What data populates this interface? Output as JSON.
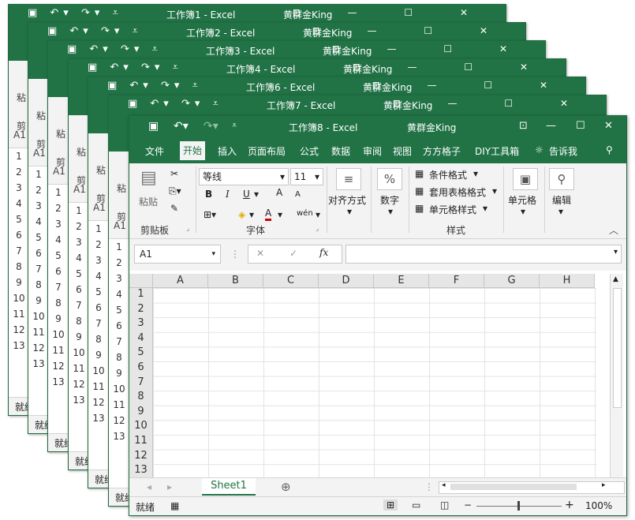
{
  "app": "Excel",
  "back_windows": [
    {
      "title": "工作簿1  -  Excel",
      "user": "黄群金King"
    },
    {
      "title": "工作簿2  -  Excel",
      "user": "黄群金King"
    },
    {
      "title": "工作簿3  -  Excel",
      "user": "黄群金King"
    },
    {
      "title": "工作簿4  -  Excel",
      "user": "黄群金King"
    },
    {
      "title": "工作簿6  -  Excel",
      "user": "黄群金King"
    },
    {
      "title": "工作簿7  -  Excel",
      "user": "黄群金King"
    }
  ],
  "back_common": {
    "paste_label": "粘",
    "cut_label": "剪",
    "name_box": "A1",
    "ready": "就绪",
    "rows": [
      "1",
      "2",
      "3",
      "4",
      "5",
      "6",
      "7",
      "8",
      "9",
      "10",
      "11",
      "12",
      "13"
    ]
  },
  "front": {
    "title": "工作簿8  -  Excel",
    "user": "黄群金King",
    "quick_access": {
      "save_icon": "save-icon",
      "undo_icon": "undo-icon",
      "redo_icon": "redo-icon"
    },
    "tabs": [
      "文件",
      "开始",
      "插入",
      "页面布局",
      "公式",
      "数据",
      "审阅",
      "视图",
      "方方格子",
      "DIY工具箱"
    ],
    "tell_me": "告诉我",
    "ribbon": {
      "paste": "粘贴",
      "clipboard": "剪贴板",
      "font_name": "等线",
      "font_size": "11",
      "bold": "B",
      "italic": "I",
      "underline": "U",
      "grow": "A",
      "shrink": "A",
      "font_color": "A",
      "phonetic": "wén",
      "font_group": "字体",
      "align": "对齐方式",
      "number": "数字",
      "number_symbol": "%",
      "cond_format": "条件格式",
      "table_format": "套用表格格式",
      "cell_style": "单元格样式",
      "styles_group": "样式",
      "cells": "单元格",
      "editing": "编辑"
    },
    "formula_bar": {
      "name_box": "A1",
      "fx": "fx",
      "cancel": "✕",
      "enter": "✓"
    },
    "columns": [
      "A",
      "B",
      "C",
      "D",
      "E",
      "F",
      "G",
      "H"
    ],
    "rows": [
      "1",
      "2",
      "3",
      "4",
      "5",
      "6",
      "7",
      "8",
      "9",
      "10",
      "11",
      "12",
      "13"
    ],
    "sheet_tab": "Sheet1",
    "status": "就绪",
    "zoom": "100%"
  }
}
